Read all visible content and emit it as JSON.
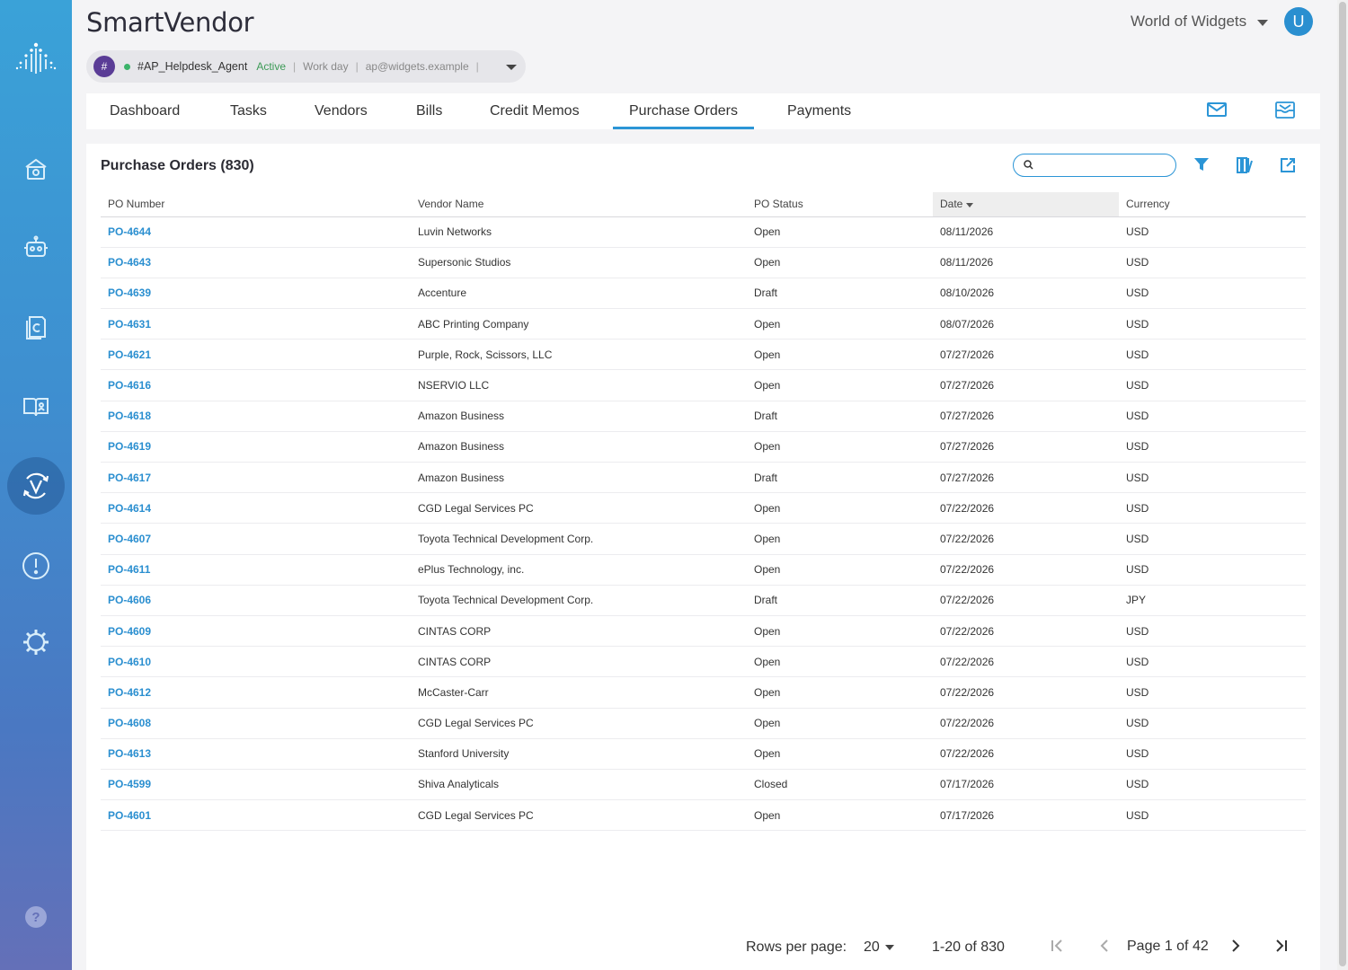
{
  "app": {
    "title": "SmartVendor",
    "org": "World of Widgets",
    "avatar_initial": "U"
  },
  "agent": {
    "hash": "#",
    "name": "#AP_Helpdesk_Agent",
    "status": "Active",
    "sep": "|",
    "schedule": "Work day",
    "email": "ap@widgets.example"
  },
  "sidebar": {
    "items": [
      "logo-icon",
      "home-icon",
      "robot-icon",
      "contracts-icon",
      "catalog-icon",
      "vendor-portal-icon",
      "alert-icon",
      "settings-icon",
      "help-icon"
    ],
    "active": "vendor-portal-icon"
  },
  "nav": {
    "tabs": [
      "Dashboard",
      "Tasks",
      "Vendors",
      "Bills",
      "Credit Memos",
      "Purchase Orders",
      "Payments"
    ],
    "active": "Purchase Orders",
    "icons": [
      "mail-icon",
      "inbox-icon"
    ]
  },
  "card": {
    "title": "Purchase Orders (830)",
    "search_placeholder": ""
  },
  "table": {
    "columns": [
      "PO Number",
      "Vendor Name",
      "PO Status",
      "Date",
      "Currency"
    ],
    "sorted_column": "Date",
    "rows": [
      [
        "PO-4644",
        "Luvin Networks",
        "Open",
        "08/11/2026",
        "USD"
      ],
      [
        "PO-4643",
        "Supersonic Studios",
        "Open",
        "08/11/2026",
        "USD"
      ],
      [
        "PO-4639",
        "Accenture",
        "Draft",
        "08/10/2026",
        "USD"
      ],
      [
        "PO-4631",
        "ABC Printing Company",
        "Open",
        "08/07/2026",
        "USD"
      ],
      [
        "PO-4621",
        "Purple, Rock, Scissors, LLC",
        "Open",
        "07/27/2026",
        "USD"
      ],
      [
        "PO-4616",
        "NSERVIO LLC",
        "Open",
        "07/27/2026",
        "USD"
      ],
      [
        "PO-4618",
        "Amazon Business",
        "Draft",
        "07/27/2026",
        "USD"
      ],
      [
        "PO-4619",
        "Amazon Business",
        "Open",
        "07/27/2026",
        "USD"
      ],
      [
        "PO-4617",
        "Amazon Business",
        "Draft",
        "07/27/2026",
        "USD"
      ],
      [
        "PO-4614",
        "CGD Legal Services PC",
        "Open",
        "07/22/2026",
        "USD"
      ],
      [
        "PO-4607",
        "Toyota Technical Development Corp.",
        "Open",
        "07/22/2026",
        "USD"
      ],
      [
        "PO-4611",
        "ePlus Technology, inc.",
        "Open",
        "07/22/2026",
        "USD"
      ],
      [
        "PO-4606",
        "Toyota Technical Development Corp.",
        "Draft",
        "07/22/2026",
        "JPY"
      ],
      [
        "PO-4609",
        "CINTAS CORP",
        "Open",
        "07/22/2026",
        "USD"
      ],
      [
        "PO-4610",
        "CINTAS CORP",
        "Open",
        "07/22/2026",
        "USD"
      ],
      [
        "PO-4612",
        "McCaster-Carr",
        "Open",
        "07/22/2026",
        "USD"
      ],
      [
        "PO-4608",
        "CGD Legal Services PC",
        "Open",
        "07/22/2026",
        "USD"
      ],
      [
        "PO-4613",
        "Stanford University",
        "Open",
        "07/22/2026",
        "USD"
      ],
      [
        "PO-4599",
        "Shiva Analyticals",
        "Closed",
        "07/17/2026",
        "USD"
      ],
      [
        "PO-4601",
        "CGD Legal Services PC",
        "Open",
        "07/17/2026",
        "USD"
      ]
    ]
  },
  "pagination": {
    "rows_label": "Rows per page:",
    "rows_value": "20",
    "range": "1-20 of 830",
    "page": "Page 1 of 42"
  },
  "colors": {
    "accent": "#2b95d6",
    "link": "#2b8fd0",
    "agent_badge": "#5a3c96",
    "active_dot": "#3bb36a"
  }
}
